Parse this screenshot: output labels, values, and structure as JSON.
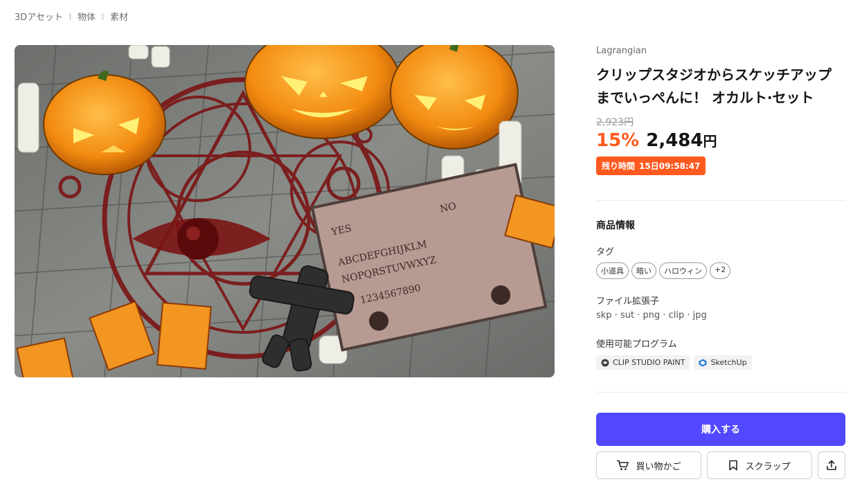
{
  "breadcrumb": [
    "3Dアセット",
    "物体",
    "素材"
  ],
  "product": {
    "seller": "Lagrangian",
    "title_line1": "クリップスタジオからスケッチアップ",
    "title_line2": "までいっぺんに！ オカルト·セット",
    "original_price": "2,923円",
    "discount": "15%",
    "price": "2,484",
    "price_unit": "円",
    "timer_label": "残り時間",
    "timer_value": "15日09:58:47"
  },
  "info": {
    "section_title": "商品情報",
    "tags_label": "タグ",
    "tags": [
      "小道具",
      "暗い",
      "ハロウィン",
      "+2"
    ],
    "ext_label": "ファイル拡張子",
    "extensions": "skp · sut · png · clip · jpg",
    "programs_label": "使用可能プログラム",
    "programs": [
      {
        "name": "CLIP STUDIO PAINT",
        "icon": "clip-studio-icon"
      },
      {
        "name": "SketchUp",
        "icon": "sketchup-icon"
      }
    ]
  },
  "actions": {
    "buy_label": "購入する",
    "cart_label": "買い物かご",
    "scrap_label": "スクラップ"
  },
  "colors": {
    "accent": "#5148ff",
    "discount": "#ff5a1f"
  }
}
